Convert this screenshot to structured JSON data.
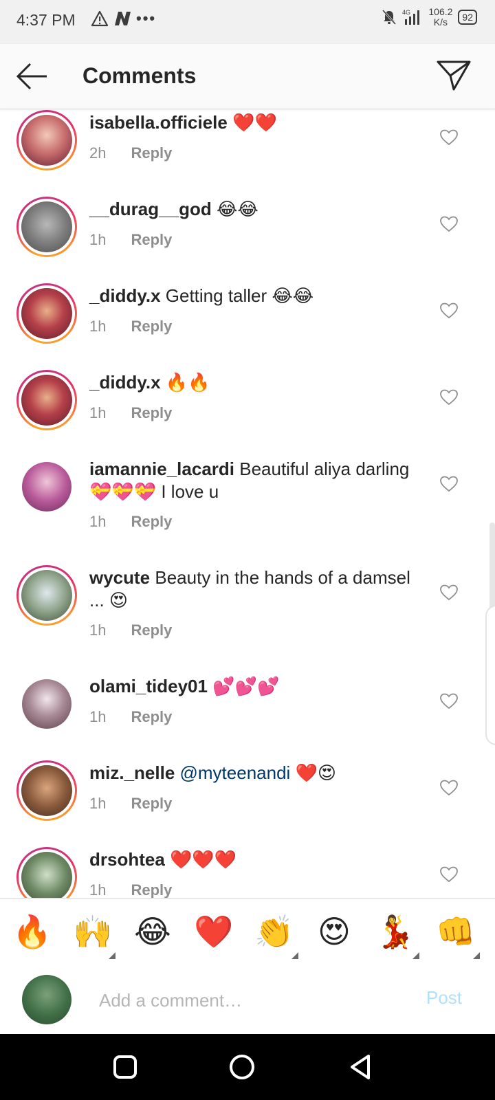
{
  "status_bar": {
    "time": "4:37 PM",
    "net_speed_value": "106.2",
    "net_speed_unit": "K/s",
    "battery": "92",
    "network": "4G"
  },
  "header": {
    "title": "Comments"
  },
  "comments": [
    {
      "username": "isabella.officiele",
      "text": " ❤️❤️",
      "time": "2h",
      "reply": "Reply"
    },
    {
      "username": "__durag__god",
      "text": " 😂😂",
      "time": "1h",
      "reply": "Reply"
    },
    {
      "username": "_diddy.x",
      "text": " Getting taller 😂😂",
      "time": "1h",
      "reply": "Reply"
    },
    {
      "username": "_diddy.x",
      "text": " 🔥🔥",
      "time": "1h",
      "reply": "Reply"
    },
    {
      "username": "iamannie_lacardi",
      "text": " Beautiful aliya darling 💝💝💝 I love u",
      "time": "1h",
      "reply": "Reply"
    },
    {
      "username": "wycute",
      "text": " Beauty in the hands of a damsel ... 😍",
      "time": "1h",
      "reply": "Reply"
    },
    {
      "username": "olami_tidey01",
      "text": " 💕💕💕",
      "time": "1h",
      "reply": "Reply"
    },
    {
      "username": "miz._nelle",
      "mention": " @myteenandi",
      "text": " ❤️😍",
      "time": "1h",
      "reply": "Reply"
    },
    {
      "username": "drsohtea",
      "text": " ❤️❤️❤️",
      "time": "1h",
      "reply": "Reply"
    }
  ],
  "emoji_bar": [
    "🔥",
    "🙌",
    "😂",
    "❤️",
    "👏",
    "😍",
    "💃",
    "👊"
  ],
  "composer": {
    "placeholder": "Add a comment…",
    "post_label": "Post"
  },
  "colors": {
    "accent": "#0095f6",
    "post_disabled": "#b2dffc",
    "mention": "#00376b",
    "muted": "#8e8e8e"
  }
}
